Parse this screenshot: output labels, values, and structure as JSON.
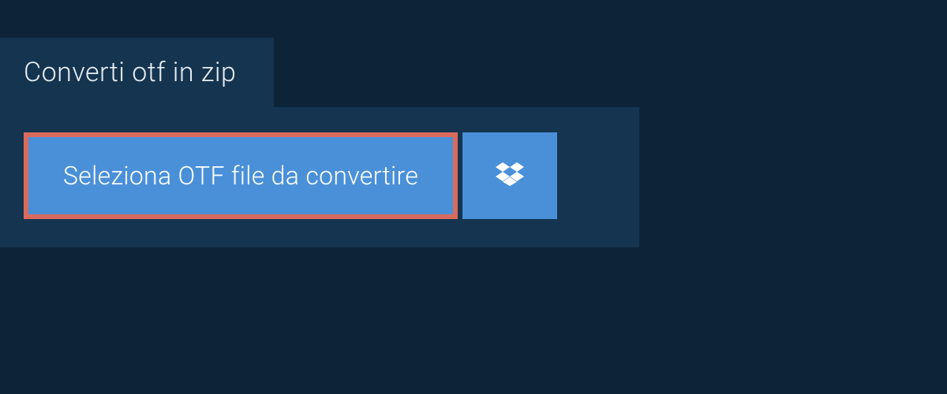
{
  "header": {
    "title": "Converti otf in zip"
  },
  "actions": {
    "select_file_label": "Seleziona OTF file da convertire",
    "dropbox_icon_name": "dropbox"
  },
  "colors": {
    "background": "#0d2438",
    "panel": "#153450",
    "button": "#4a90d9",
    "highlight_border": "#d96b5c"
  }
}
